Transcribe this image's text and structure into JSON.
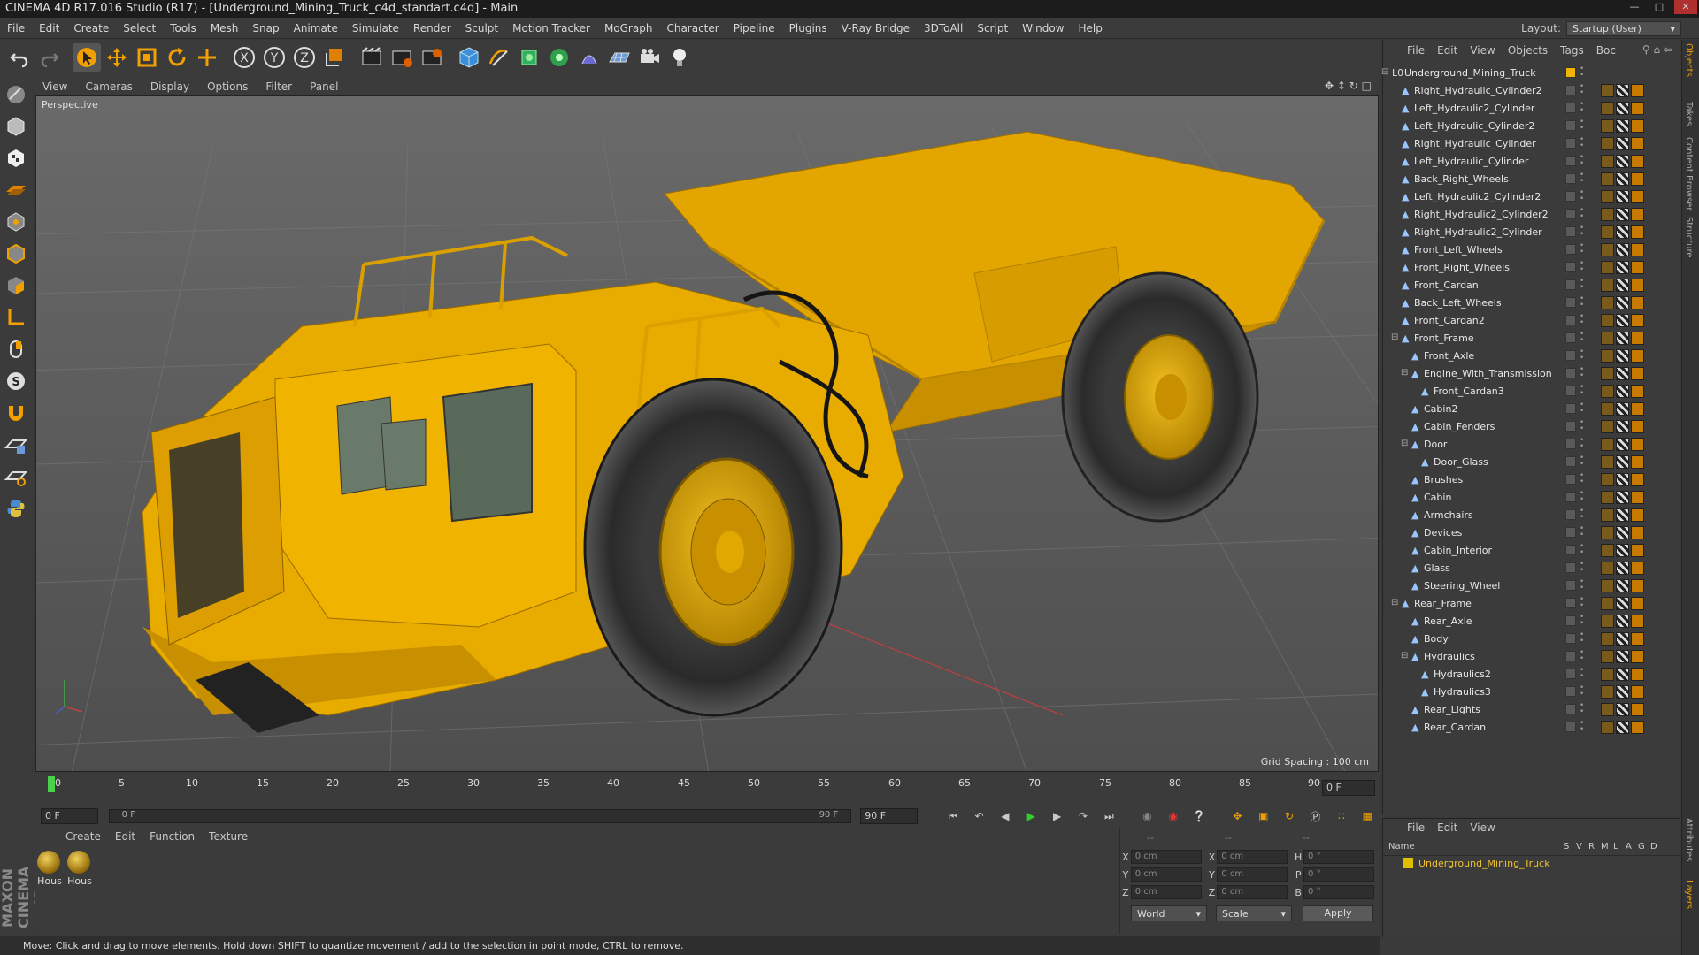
{
  "window": {
    "title": "CINEMA 4D R17.016 Studio (R17) - [Underground_Mining_Truck_c4d_standart.c4d] - Main"
  },
  "menu": [
    "File",
    "Edit",
    "Create",
    "Select",
    "Tools",
    "Mesh",
    "Snap",
    "Animate",
    "Simulate",
    "Render",
    "Sculpt",
    "Motion Tracker",
    "MoGraph",
    "Character",
    "Pipeline",
    "Plugins",
    "V-Ray Bridge",
    "3DToAll",
    "Script",
    "Window",
    "Help"
  ],
  "layout": {
    "label": "Layout:",
    "value": "Startup (User)"
  },
  "toolbar_icons": [
    "undo-icon",
    "redo-icon",
    "select-arrow-icon",
    "move-icon",
    "scale-icon",
    "rotate-icon",
    "move-plus-icon",
    "x-axis-icon",
    "y-axis-icon",
    "z-axis-icon",
    "coordinate-system-icon",
    "render-view-icon",
    "render-picture-viewer-icon",
    "edit-render-settings-icon",
    "cube-icon",
    "pen-spline-icon",
    "subdivision-icon",
    "mograph-cloner-icon",
    "deformer-icon",
    "floor-icon",
    "camera-icon",
    "light-icon"
  ],
  "viewport": {
    "menu": [
      "View",
      "Cameras",
      "Display",
      "Options",
      "Filter",
      "Panel"
    ],
    "label": "Perspective",
    "grid_spacing": "Grid Spacing : 100 cm"
  },
  "timeline": {
    "ticks": [
      "0",
      "5",
      "10",
      "15",
      "20",
      "25",
      "30",
      "35",
      "40",
      "45",
      "50",
      "55",
      "60",
      "65",
      "70",
      "75",
      "80",
      "85",
      "90"
    ],
    "frame_field": "0 F",
    "start_field": "0 F",
    "slider_left": "0 F",
    "slider_right": "90 F",
    "end_field": "90 F"
  },
  "material_panel": {
    "menu": [
      "Create",
      "Edit",
      "Function",
      "Texture"
    ],
    "materials": [
      "Hous",
      "Hous"
    ]
  },
  "coords": {
    "headers": [
      "--",
      "--",
      "--"
    ],
    "rows": [
      {
        "l1": "X",
        "v1": "0 cm",
        "l2": "X",
        "v2": "0 cm",
        "l3": "H",
        "v3": "0 °"
      },
      {
        "l1": "Y",
        "v1": "0 cm",
        "l2": "Y",
        "v2": "0 cm",
        "l3": "P",
        "v3": "0 °"
      },
      {
        "l1": "Z",
        "v1": "0 cm",
        "l2": "Z",
        "v2": "0 cm",
        "l3": "B",
        "v3": "0 °"
      }
    ],
    "mode": "World",
    "type": "Scale",
    "apply": "Apply"
  },
  "status": "Move: Click and drag to move elements. Hold down SHIFT to quantize movement / add to the selection in point mode, CTRL to remove.",
  "object_manager": {
    "menu": [
      "File",
      "Edit",
      "View",
      "Objects",
      "Tags",
      "Boc"
    ],
    "objects": [
      {
        "name": "Underground_Mining_Truck",
        "depth": 0,
        "type": "null",
        "expand": "-"
      },
      {
        "name": "Right_Hydraulic_Cylinder2",
        "depth": 1,
        "type": "mesh",
        "expand": ""
      },
      {
        "name": "Left_Hydraulic2_Cylinder",
        "depth": 1,
        "type": "mesh",
        "expand": ""
      },
      {
        "name": "Left_Hydraulic_Cylinder2",
        "depth": 1,
        "type": "mesh",
        "expand": ""
      },
      {
        "name": "Right_Hydraulic_Cylinder",
        "depth": 1,
        "type": "mesh",
        "expand": ""
      },
      {
        "name": "Left_Hydraulic_Cylinder",
        "depth": 1,
        "type": "mesh",
        "expand": ""
      },
      {
        "name": "Back_Right_Wheels",
        "depth": 1,
        "type": "mesh",
        "expand": ""
      },
      {
        "name": "Left_Hydraulic2_Cylinder2",
        "depth": 1,
        "type": "mesh",
        "expand": ""
      },
      {
        "name": "Right_Hydraulic2_Cylinder2",
        "depth": 1,
        "type": "mesh",
        "expand": ""
      },
      {
        "name": "Right_Hydraulic2_Cylinder",
        "depth": 1,
        "type": "mesh",
        "expand": ""
      },
      {
        "name": "Front_Left_Wheels",
        "depth": 1,
        "type": "mesh",
        "expand": ""
      },
      {
        "name": "Front_Right_Wheels",
        "depth": 1,
        "type": "mesh",
        "expand": ""
      },
      {
        "name": "Front_Cardan",
        "depth": 1,
        "type": "mesh",
        "expand": ""
      },
      {
        "name": "Back_Left_Wheels",
        "depth": 1,
        "type": "mesh",
        "expand": ""
      },
      {
        "name": "Front_Cardan2",
        "depth": 1,
        "type": "mesh",
        "expand": ""
      },
      {
        "name": "Front_Frame",
        "depth": 1,
        "type": "mesh",
        "expand": "-"
      },
      {
        "name": "Front_Axle",
        "depth": 2,
        "type": "mesh",
        "expand": ""
      },
      {
        "name": "Engine_With_Transmission",
        "depth": 2,
        "type": "mesh",
        "expand": "-"
      },
      {
        "name": "Front_Cardan3",
        "depth": 3,
        "type": "mesh",
        "expand": ""
      },
      {
        "name": "Cabin2",
        "depth": 2,
        "type": "mesh",
        "expand": ""
      },
      {
        "name": "Cabin_Fenders",
        "depth": 2,
        "type": "mesh",
        "expand": ""
      },
      {
        "name": "Door",
        "depth": 2,
        "type": "mesh",
        "expand": "-"
      },
      {
        "name": "Door_Glass",
        "depth": 3,
        "type": "mesh",
        "expand": ""
      },
      {
        "name": "Brushes",
        "depth": 2,
        "type": "mesh",
        "expand": ""
      },
      {
        "name": "Cabin",
        "depth": 2,
        "type": "mesh",
        "expand": ""
      },
      {
        "name": "Armchairs",
        "depth": 2,
        "type": "mesh",
        "expand": ""
      },
      {
        "name": "Devices",
        "depth": 2,
        "type": "mesh",
        "expand": ""
      },
      {
        "name": "Cabin_Interior",
        "depth": 2,
        "type": "mesh",
        "expand": ""
      },
      {
        "name": "Glass",
        "depth": 2,
        "type": "mesh",
        "expand": ""
      },
      {
        "name": "Steering_Wheel",
        "depth": 2,
        "type": "mesh",
        "expand": ""
      },
      {
        "name": "Rear_Frame",
        "depth": 1,
        "type": "mesh",
        "expand": "-"
      },
      {
        "name": "Rear_Axle",
        "depth": 2,
        "type": "mesh",
        "expand": ""
      },
      {
        "name": "Body",
        "depth": 2,
        "type": "mesh",
        "expand": ""
      },
      {
        "name": "Hydraulics",
        "depth": 2,
        "type": "mesh",
        "expand": "-"
      },
      {
        "name": "Hydraulics2",
        "depth": 3,
        "type": "mesh",
        "expand": ""
      },
      {
        "name": "Hydraulics3",
        "depth": 3,
        "type": "mesh",
        "expand": ""
      },
      {
        "name": "Rear_Lights",
        "depth": 2,
        "type": "mesh",
        "expand": ""
      },
      {
        "name": "Rear_Cardan",
        "depth": 2,
        "type": "mesh",
        "expand": ""
      }
    ]
  },
  "layer_manager": {
    "menu": [
      "File",
      "Edit",
      "View"
    ],
    "columns": [
      "Name",
      "S",
      "V",
      "R",
      "M",
      "L",
      "A",
      "G",
      "D"
    ],
    "row": "Underground_Mining_Truck"
  },
  "right_tabs": [
    "Objects",
    "Takes",
    "Content Browser",
    "Structure",
    "Attributes",
    "Layers"
  ],
  "brand": "MAXON CINEMA 4D",
  "colors": {
    "accent": "#f0b400",
    "selected_text": "#f0c030",
    "truck": "#e6a800"
  }
}
